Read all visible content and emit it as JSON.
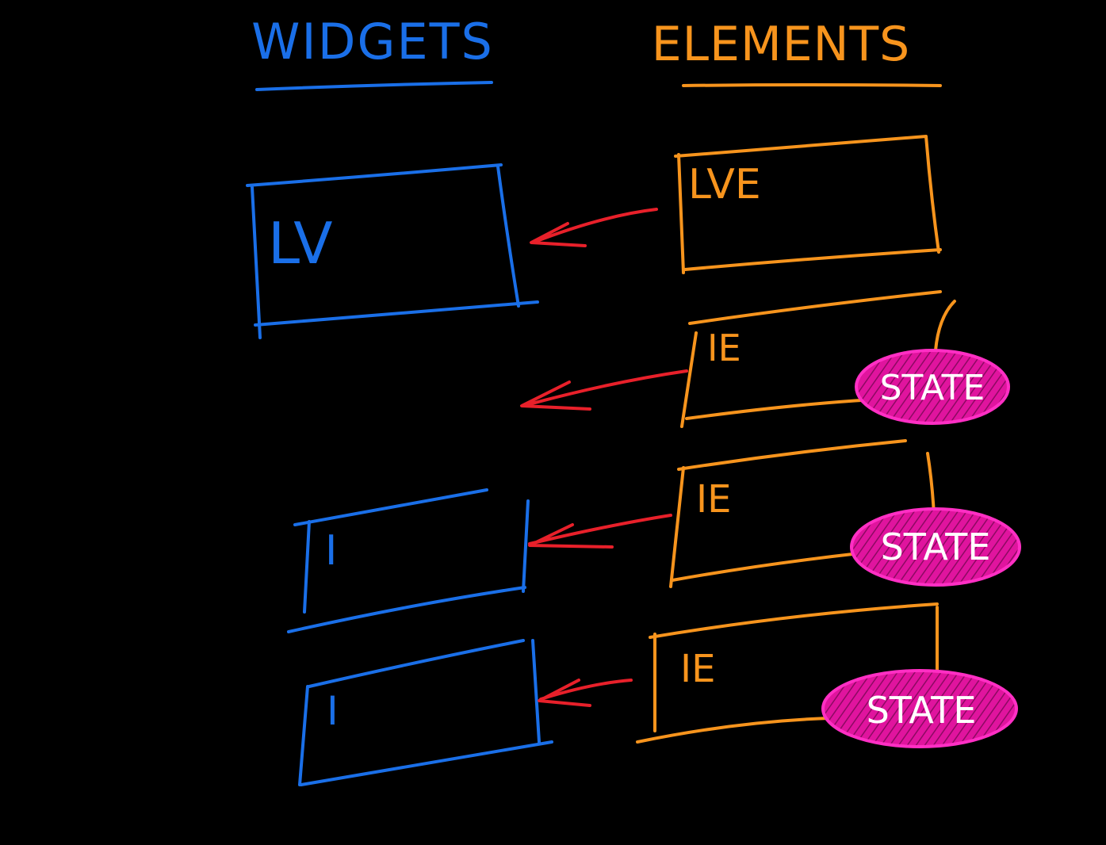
{
  "colors": {
    "background": "#000000",
    "widgets": "#1a6fe8",
    "elements": "#f7941d",
    "arrow": "#e8202a",
    "state_fill": "#e0149e",
    "state_outline": "#ff2fc4",
    "state_text": "#ffffff"
  },
  "headers": {
    "widgets": "WIDGETS",
    "elements": "ELEMENTS"
  },
  "widgets": [
    {
      "label": "LV"
    },
    {
      "label": "I"
    },
    {
      "label": "I"
    }
  ],
  "elements": [
    {
      "label": "LVE"
    },
    {
      "label": "IE",
      "state": "STATE"
    },
    {
      "label": "IE",
      "state": "STATE"
    },
    {
      "label": "IE",
      "state": "STATE"
    }
  ]
}
